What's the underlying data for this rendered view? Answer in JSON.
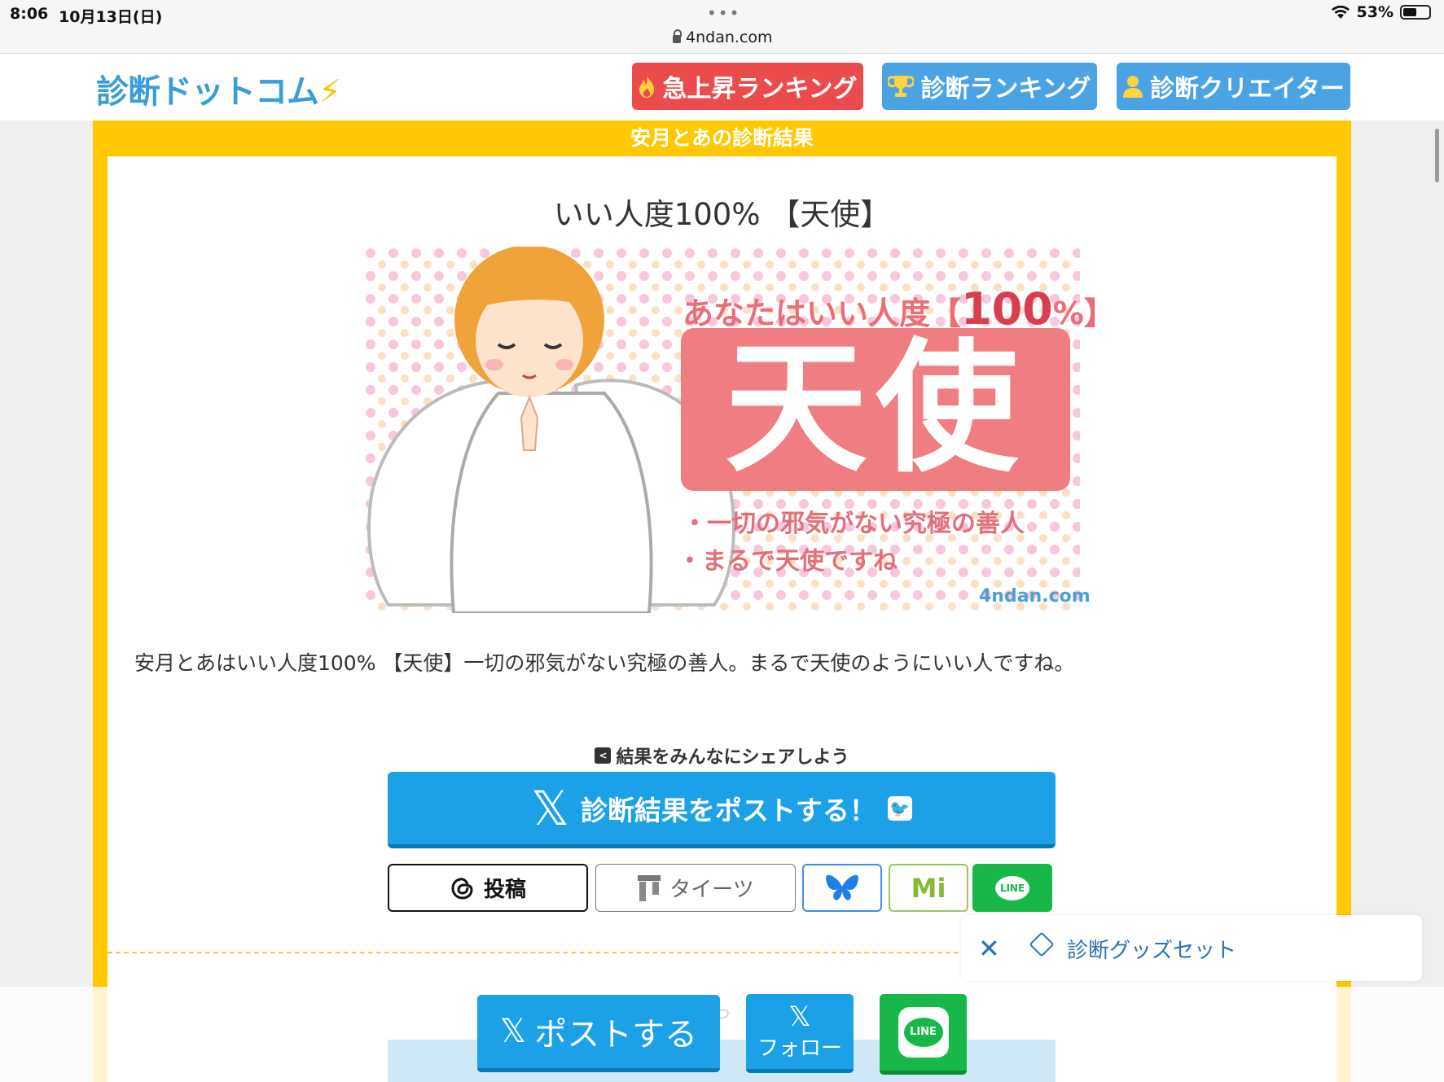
{
  "status_bar": {
    "time": "8:06",
    "date": "10月13日(日)",
    "battery": "53%"
  },
  "browser": {
    "url": "4ndan.com"
  },
  "header": {
    "logo": "診断ドットコム",
    "nav": {
      "hot_ranking": "急上昇ランキング",
      "ranking": "診断ランキング",
      "creator": "診断クリエイター"
    }
  },
  "result": {
    "banner": "安月とあの診断結果",
    "title": "いい人度100% 【天使】",
    "image_text": {
      "headline": "あなたはいい人度【",
      "percent": "100",
      "percent_suffix": "%】",
      "big": "天使",
      "line1": "・一切の邪気がない究極の善人",
      "line2": "・まるで天使ですね",
      "brand": "4ndan.com"
    },
    "description": "安月とあはいい人度100% 【天使】一切の邪気がない究極の善人。まるで天使のようにいい人ですね。"
  },
  "share": {
    "heading": "結果をみんなにシェアしよう",
    "post_label": "診断結果をポストする！",
    "threads_label": "投稿",
    "taits_label": "タイーツ",
    "misskey_label": "Mi",
    "line_label": "LINE"
  },
  "goods": {
    "label": "診断グッズセット"
  },
  "bottom_bar": {
    "post_label": "ポストする",
    "follow_label": "フォロー",
    "line_label": "LINE"
  },
  "colors": {
    "frame": "#ffc800",
    "twitter_blue": "#1ca0e8",
    "hot_red": "#ec4b4b",
    "line_green": "#17b74a"
  }
}
